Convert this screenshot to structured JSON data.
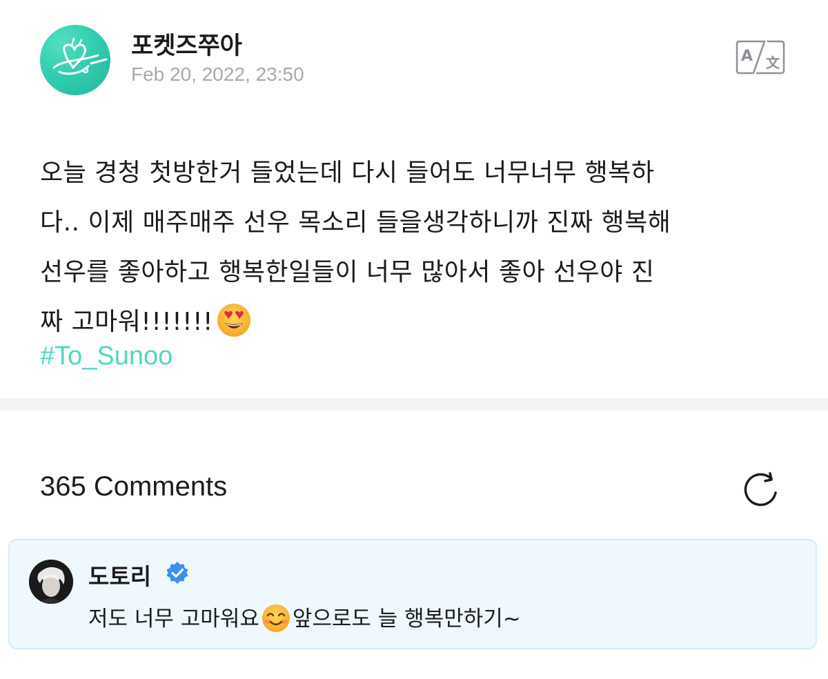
{
  "post": {
    "author": "포켓즈쭈아",
    "timestamp": "Feb 20, 2022, 23:50",
    "avatar_icon": "heart-doodle-icon",
    "translate_icon": "translate-icon",
    "body_lines": [
      "오늘 경청 첫방한거 들었는데 다시 들어도 너무너무 행복하",
      "다.. 이제 매주매주 선우 목소리 들을생각하니까 진짜 행복해",
      "선우를 좋아하고 행복한일들이 너무 많아서 좋아 선우야 진",
      "짜 고마워!!!!!!!"
    ],
    "body_emoji": "heart-eyes-emoji",
    "hashtag": "#To_Sunoo",
    "hashtag_color": "#4fd7c2"
  },
  "comments": {
    "count_label": "365 Comments",
    "refresh_icon": "refresh-icon",
    "highlighted": {
      "author": "도토리",
      "verified_icon": "verified-badge-icon",
      "text_before_emoji": "저도 너무 고마워요",
      "emoji": "smiling-face-emoji",
      "text_after_emoji": "앞으로도 늘 행복만하기~",
      "background_color": "#eff8fc"
    }
  }
}
